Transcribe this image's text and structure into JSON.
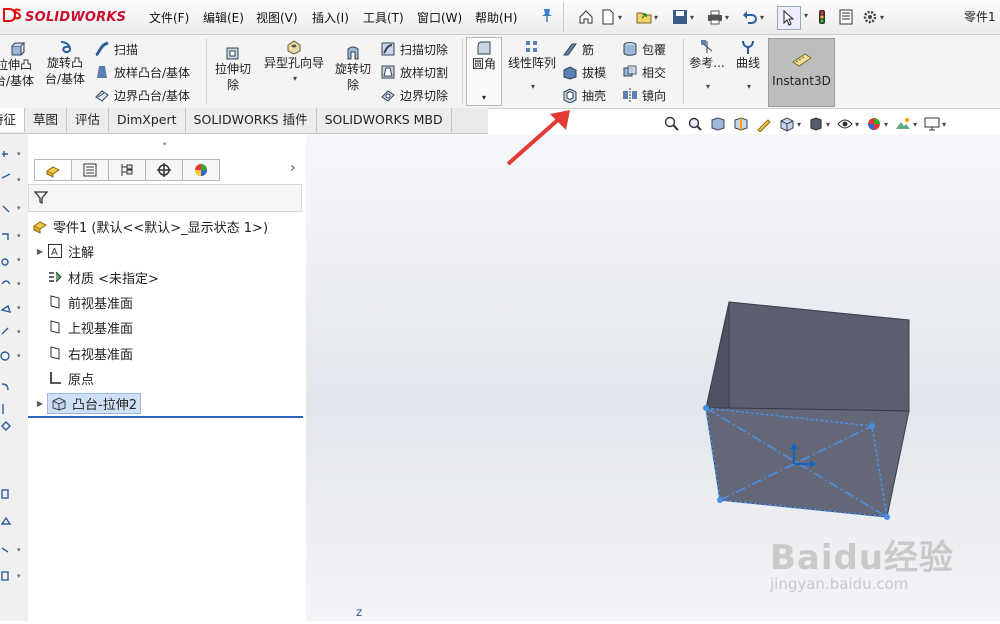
{
  "app": {
    "logo_text": "SOLIDWORKS",
    "doc_title": "零件1"
  },
  "menu": [
    "文件(F)",
    "编辑(E)",
    "视图(V)",
    "插入(I)",
    "工具(T)",
    "窗口(W)",
    "帮助(H)"
  ],
  "ribbon": {
    "extrude_boss": "拉伸凸\n台/基体",
    "revolve_boss": "旋转凸\n台/基体",
    "sweep": "扫描",
    "loft_boss": "放样凸台/基体",
    "boundary_boss": "边界凸台/基体",
    "extrude_cut": "拉伸切\n除",
    "hole_wizard": "异型孔向导",
    "revolve_cut": "旋转切\n除",
    "swept_cut": "扫描切除",
    "lofted_cut": "放样切割",
    "boundary_cut": "边界切除",
    "fillet": "圆角",
    "linear_pattern": "线性阵列",
    "rib": "筋",
    "draft": "拔模",
    "shell": "抽壳",
    "wrap": "包覆",
    "intersect": "相交",
    "mirror": "镜向",
    "reference": "参考...",
    "curves": "曲线",
    "instant3d": "Instant3D"
  },
  "tabs": [
    "特征",
    "草图",
    "评估",
    "DimXpert",
    "SOLIDWORKS 插件",
    "SOLIDWORKS MBD"
  ],
  "tree": {
    "root": "零件1 (默认<<默认>_显示状态 1>)",
    "items": [
      "注解",
      "材质 <未指定>",
      "前视基准面",
      "上视基准面",
      "右视基准面",
      "原点",
      "凸台-拉伸2"
    ]
  },
  "triad_label": "Z",
  "watermark": {
    "brand": "Baidu经验",
    "url": "jingyan.baidu.com"
  },
  "colors": {
    "accent": "#2c63c4",
    "box_face": "#5a5d6e",
    "arrow": "#e53935",
    "logo_red": "#c8102e"
  }
}
